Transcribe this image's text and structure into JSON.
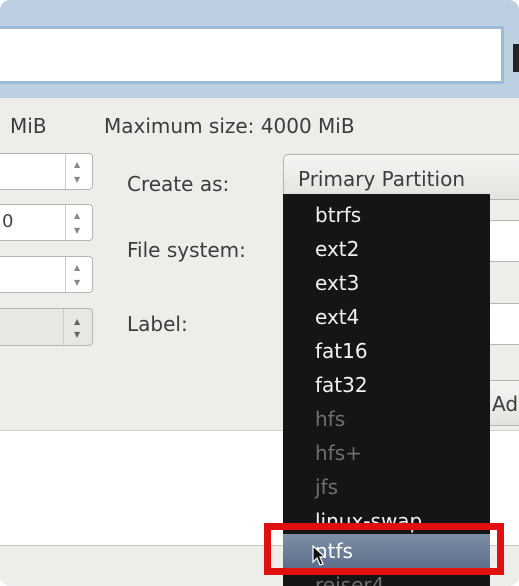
{
  "dialog": {
    "min_size_suffix": "MiB",
    "max_size_label": "Maximum size: 4000 MiB",
    "spin_fields": [
      {
        "value": ""
      },
      {
        "value": "0"
      },
      {
        "value": ""
      }
    ],
    "create_as_label": "Create as:",
    "create_as_value": "Primary Partition",
    "file_system_label": "File system:",
    "label_label": "Label:",
    "add_button_label": "Ad"
  },
  "filesystem_menu": {
    "items": [
      {
        "label": "btrfs",
        "enabled": true,
        "selected": false
      },
      {
        "label": "ext2",
        "enabled": true,
        "selected": false
      },
      {
        "label": "ext3",
        "enabled": true,
        "selected": false
      },
      {
        "label": "ext4",
        "enabled": true,
        "selected": false
      },
      {
        "label": "fat16",
        "enabled": true,
        "selected": false
      },
      {
        "label": "fat32",
        "enabled": true,
        "selected": false
      },
      {
        "label": "hfs",
        "enabled": false,
        "selected": false
      },
      {
        "label": "hfs+",
        "enabled": false,
        "selected": false
      },
      {
        "label": "jfs",
        "enabled": false,
        "selected": false
      },
      {
        "label": "linux-swap",
        "enabled": true,
        "selected": false
      },
      {
        "label": "ntfs",
        "enabled": true,
        "selected": true
      },
      {
        "label": "reiser4",
        "enabled": false,
        "selected": false
      }
    ]
  },
  "colors": {
    "highlight_box": "#e01010",
    "menu_background": "#151515",
    "selected_item": "#6b7d97"
  }
}
